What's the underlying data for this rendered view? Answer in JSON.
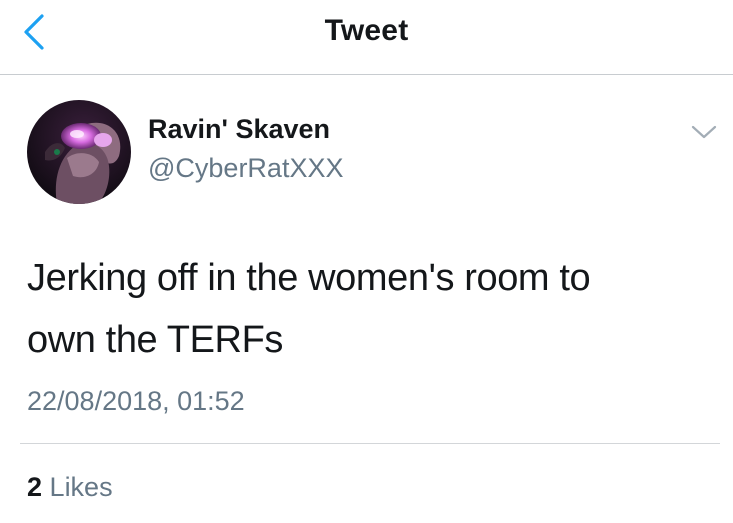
{
  "header": {
    "back_icon": "chevron-left-icon",
    "title": "Tweet"
  },
  "tweet": {
    "author": {
      "display_name": "Ravin' Skaven",
      "handle": "@CyberRatXXX",
      "avatar": "avatar-image"
    },
    "more_icon": "chevron-down-icon",
    "text_lines": [
      "Jerking off in the women's room to",
      "own the TERFs"
    ],
    "timestamp": "22/08/2018, 01:52",
    "stats": {
      "likes_count": "2",
      "likes_label": "Likes"
    }
  },
  "colors": {
    "accent": "#1da1f2",
    "text_primary": "#14171a",
    "text_secondary": "#657786",
    "divider": "#d3d6d9"
  }
}
